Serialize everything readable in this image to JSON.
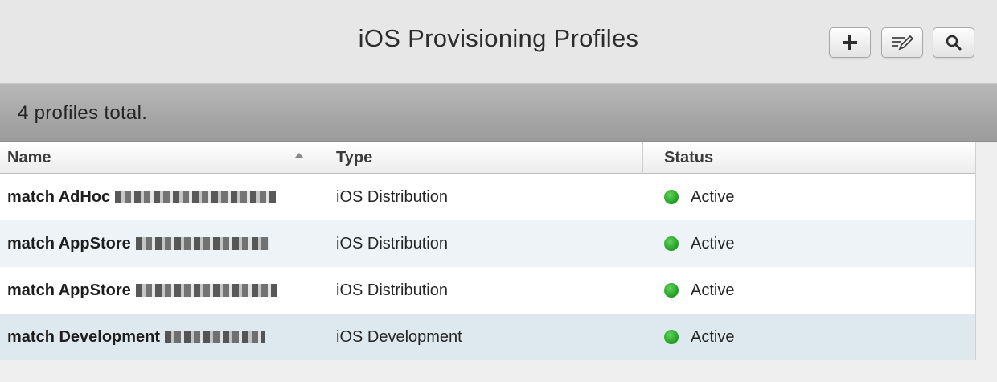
{
  "window": {
    "title": "iOS Provisioning Profiles"
  },
  "toolbar": {
    "buttons": [
      {
        "icon": "plus-icon",
        "action": "add"
      },
      {
        "icon": "edit-icon",
        "action": "edit"
      },
      {
        "icon": "search-icon",
        "action": "search"
      }
    ]
  },
  "summary": {
    "text": "4 profiles total."
  },
  "table": {
    "columns": [
      "Name",
      "Type",
      "Status"
    ],
    "sort_column": "Name",
    "sort_direction": "ascending",
    "rows": [
      {
        "name": "match AdHoc",
        "type": "iOS Distribution",
        "status": "Active"
      },
      {
        "name": "match AppStore",
        "type": "iOS Distribution",
        "status": "Active"
      },
      {
        "name": "match AppStore",
        "type": "iOS Distribution",
        "status": "Active"
      },
      {
        "name": "match Development",
        "type": "iOS Development",
        "status": "Active"
      }
    ]
  },
  "colors": {
    "status_active": "#2aa52a",
    "row_alt": "#edf3f6",
    "row_selected": "#dde9ef"
  }
}
